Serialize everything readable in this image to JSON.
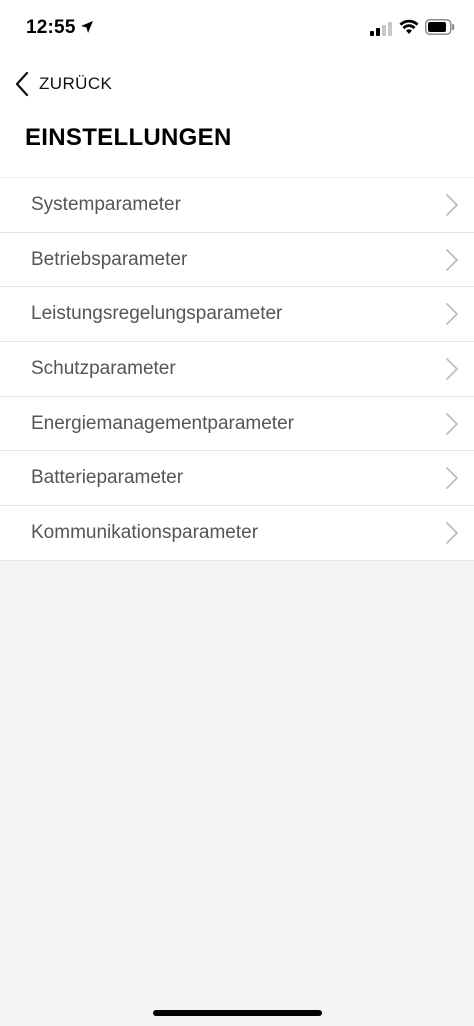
{
  "status_bar": {
    "time": "12:55",
    "icons": [
      "location-arrow-icon",
      "cellular-signal-icon",
      "wifi-icon",
      "battery-icon"
    ]
  },
  "nav": {
    "back_label": "ZURÜCK",
    "back_icon": "chevron-left-icon"
  },
  "page": {
    "title": "EINSTELLUNGEN"
  },
  "menu": {
    "items": [
      {
        "label": "Systemparameter"
      },
      {
        "label": "Betriebsparameter"
      },
      {
        "label": "Leistungsregelungsparameter"
      },
      {
        "label": "Schutzparameter"
      },
      {
        "label": "Energiemanagementparameter"
      },
      {
        "label": "Batterieparameter"
      },
      {
        "label": "Kommunikationsparameter"
      }
    ],
    "item_icon": "chevron-right-icon"
  },
  "colors": {
    "background": "#f3f3f3",
    "surface": "#ffffff",
    "text_primary": "#000000",
    "text_secondary": "#555555",
    "divider": "#e4e4e4",
    "chevron": "#bdbdbd"
  }
}
